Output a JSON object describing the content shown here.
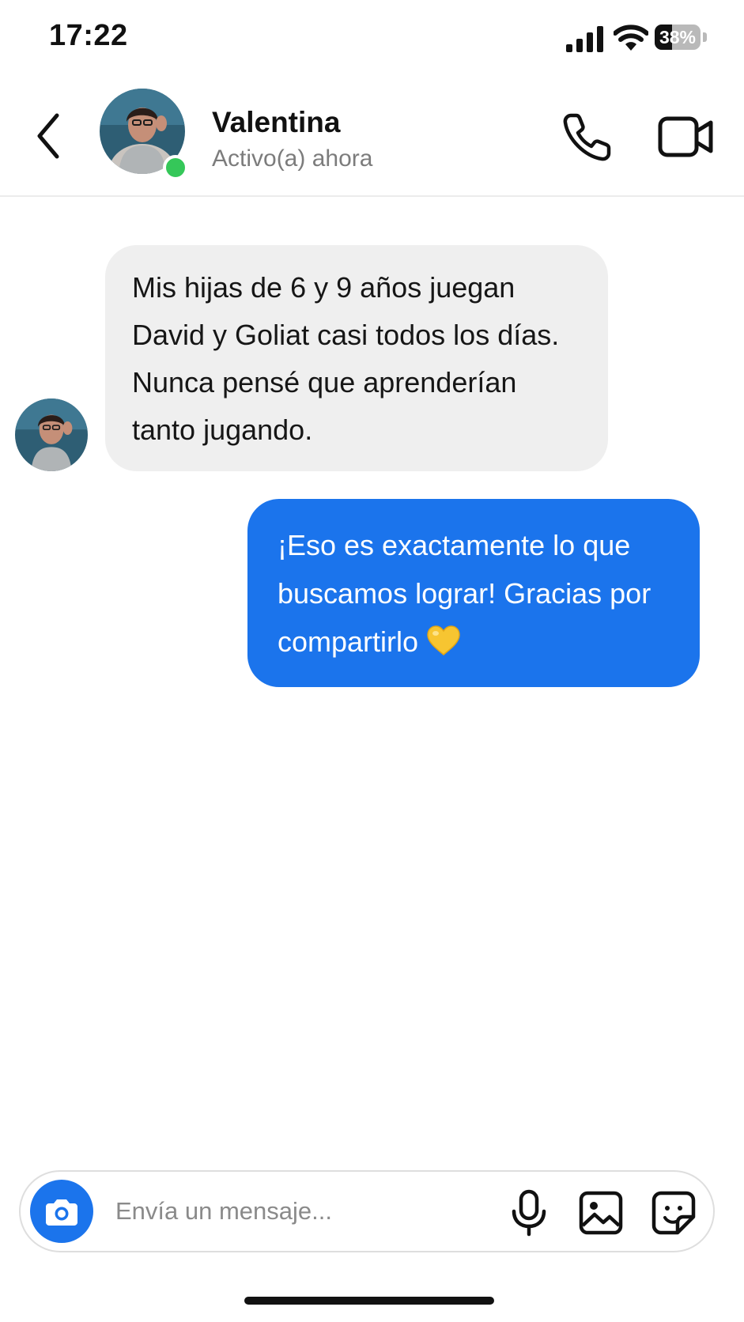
{
  "status_bar": {
    "time": "17:22",
    "battery_text": "38%",
    "battery_level": 0.38,
    "icons": [
      "signal-icon",
      "wifi-icon",
      "battery-icon"
    ]
  },
  "header": {
    "back_icon": "chevron-left-icon",
    "contact_name": "Valentina",
    "contact_status": "Activo(a) ahora",
    "online_color": "#35c759",
    "call_icon": "phone-icon",
    "video_icon": "video-camera-icon"
  },
  "messages": [
    {
      "direction": "incoming",
      "text": "Mis hijas de 6 y 9 años juegan David y Goliat casi todos los días. Nunca pensé que aprenderían tanto jugando.",
      "lines": [
        "Mis hijas de 6 y 9 años juegan",
        "David y Goliat casi todos los días.",
        "Nunca pensé que aprenderían",
        "tanto jugando."
      ],
      "bubble_color": "#efefef"
    },
    {
      "direction": "outgoing",
      "text": "¡Eso es exactamente lo que buscamos lograr! Gracias por compartirlo 💛",
      "lines": [
        "¡Eso es exactamente lo que",
        "buscamos lograr! Gracias por",
        "compartirlo"
      ],
      "emoji": "yellow-heart-emoji",
      "bubble_color": "#1b74ec"
    }
  ],
  "composer": {
    "placeholder": "Envía un mensaje...",
    "value": "",
    "camera_icon": "camera-icon",
    "mic_icon": "microphone-icon",
    "gallery_icon": "image-icon",
    "sticker_icon": "sticker-icon",
    "accent_color": "#1b74ec"
  }
}
